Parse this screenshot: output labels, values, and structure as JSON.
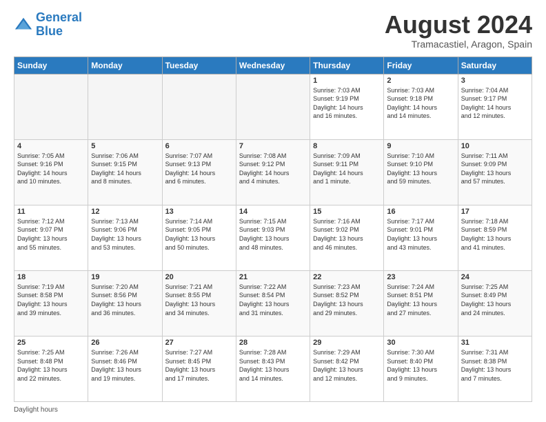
{
  "logo": {
    "line1": "General",
    "line2": "Blue"
  },
  "header": {
    "month_year": "August 2024",
    "location": "Tramacastiel, Aragon, Spain"
  },
  "days_of_week": [
    "Sunday",
    "Monday",
    "Tuesday",
    "Wednesday",
    "Thursday",
    "Friday",
    "Saturday"
  ],
  "footer": {
    "daylight_label": "Daylight hours"
  },
  "weeks": [
    [
      {
        "day": "",
        "info": ""
      },
      {
        "day": "",
        "info": ""
      },
      {
        "day": "",
        "info": ""
      },
      {
        "day": "",
        "info": ""
      },
      {
        "day": "1",
        "info": "Sunrise: 7:03 AM\nSunset: 9:19 PM\nDaylight: 14 hours\nand 16 minutes."
      },
      {
        "day": "2",
        "info": "Sunrise: 7:03 AM\nSunset: 9:18 PM\nDaylight: 14 hours\nand 14 minutes."
      },
      {
        "day": "3",
        "info": "Sunrise: 7:04 AM\nSunset: 9:17 PM\nDaylight: 14 hours\nand 12 minutes."
      }
    ],
    [
      {
        "day": "4",
        "info": "Sunrise: 7:05 AM\nSunset: 9:16 PM\nDaylight: 14 hours\nand 10 minutes."
      },
      {
        "day": "5",
        "info": "Sunrise: 7:06 AM\nSunset: 9:15 PM\nDaylight: 14 hours\nand 8 minutes."
      },
      {
        "day": "6",
        "info": "Sunrise: 7:07 AM\nSunset: 9:13 PM\nDaylight: 14 hours\nand 6 minutes."
      },
      {
        "day": "7",
        "info": "Sunrise: 7:08 AM\nSunset: 9:12 PM\nDaylight: 14 hours\nand 4 minutes."
      },
      {
        "day": "8",
        "info": "Sunrise: 7:09 AM\nSunset: 9:11 PM\nDaylight: 14 hours\nand 1 minute."
      },
      {
        "day": "9",
        "info": "Sunrise: 7:10 AM\nSunset: 9:10 PM\nDaylight: 13 hours\nand 59 minutes."
      },
      {
        "day": "10",
        "info": "Sunrise: 7:11 AM\nSunset: 9:09 PM\nDaylight: 13 hours\nand 57 minutes."
      }
    ],
    [
      {
        "day": "11",
        "info": "Sunrise: 7:12 AM\nSunset: 9:07 PM\nDaylight: 13 hours\nand 55 minutes."
      },
      {
        "day": "12",
        "info": "Sunrise: 7:13 AM\nSunset: 9:06 PM\nDaylight: 13 hours\nand 53 minutes."
      },
      {
        "day": "13",
        "info": "Sunrise: 7:14 AM\nSunset: 9:05 PM\nDaylight: 13 hours\nand 50 minutes."
      },
      {
        "day": "14",
        "info": "Sunrise: 7:15 AM\nSunset: 9:03 PM\nDaylight: 13 hours\nand 48 minutes."
      },
      {
        "day": "15",
        "info": "Sunrise: 7:16 AM\nSunset: 9:02 PM\nDaylight: 13 hours\nand 46 minutes."
      },
      {
        "day": "16",
        "info": "Sunrise: 7:17 AM\nSunset: 9:01 PM\nDaylight: 13 hours\nand 43 minutes."
      },
      {
        "day": "17",
        "info": "Sunrise: 7:18 AM\nSunset: 8:59 PM\nDaylight: 13 hours\nand 41 minutes."
      }
    ],
    [
      {
        "day": "18",
        "info": "Sunrise: 7:19 AM\nSunset: 8:58 PM\nDaylight: 13 hours\nand 39 minutes."
      },
      {
        "day": "19",
        "info": "Sunrise: 7:20 AM\nSunset: 8:56 PM\nDaylight: 13 hours\nand 36 minutes."
      },
      {
        "day": "20",
        "info": "Sunrise: 7:21 AM\nSunset: 8:55 PM\nDaylight: 13 hours\nand 34 minutes."
      },
      {
        "day": "21",
        "info": "Sunrise: 7:22 AM\nSunset: 8:54 PM\nDaylight: 13 hours\nand 31 minutes."
      },
      {
        "day": "22",
        "info": "Sunrise: 7:23 AM\nSunset: 8:52 PM\nDaylight: 13 hours\nand 29 minutes."
      },
      {
        "day": "23",
        "info": "Sunrise: 7:24 AM\nSunset: 8:51 PM\nDaylight: 13 hours\nand 27 minutes."
      },
      {
        "day": "24",
        "info": "Sunrise: 7:25 AM\nSunset: 8:49 PM\nDaylight: 13 hours\nand 24 minutes."
      }
    ],
    [
      {
        "day": "25",
        "info": "Sunrise: 7:25 AM\nSunset: 8:48 PM\nDaylight: 13 hours\nand 22 minutes."
      },
      {
        "day": "26",
        "info": "Sunrise: 7:26 AM\nSunset: 8:46 PM\nDaylight: 13 hours\nand 19 minutes."
      },
      {
        "day": "27",
        "info": "Sunrise: 7:27 AM\nSunset: 8:45 PM\nDaylight: 13 hours\nand 17 minutes."
      },
      {
        "day": "28",
        "info": "Sunrise: 7:28 AM\nSunset: 8:43 PM\nDaylight: 13 hours\nand 14 minutes."
      },
      {
        "day": "29",
        "info": "Sunrise: 7:29 AM\nSunset: 8:42 PM\nDaylight: 13 hours\nand 12 minutes."
      },
      {
        "day": "30",
        "info": "Sunrise: 7:30 AM\nSunset: 8:40 PM\nDaylight: 13 hours\nand 9 minutes."
      },
      {
        "day": "31",
        "info": "Sunrise: 7:31 AM\nSunset: 8:38 PM\nDaylight: 13 hours\nand 7 minutes."
      }
    ]
  ]
}
